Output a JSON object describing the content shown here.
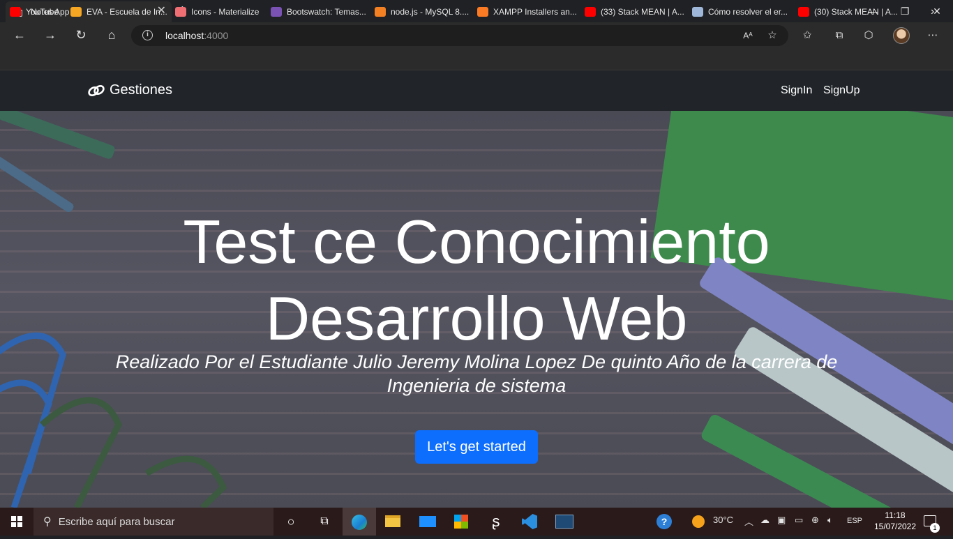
{
  "browser": {
    "tab_title": "Notes App",
    "url_host": "localhost",
    "url_port": ":4000",
    "bookmarks": [
      {
        "label": "YouTube",
        "icon": "youtube-icon",
        "color": "#ff0000"
      },
      {
        "label": "EVA - Escuela de In...",
        "icon": "eva-icon",
        "color": "#f5a623"
      },
      {
        "label": "Icons - Materialize",
        "icon": "materialize-icon",
        "color": "#ee6e73"
      },
      {
        "label": "Bootswatch: Temas...",
        "icon": "bootswatch-icon",
        "color": "#7952b3"
      },
      {
        "label": "node.js - MySQL 8....",
        "icon": "stackoverflow-icon",
        "color": "#f48024"
      },
      {
        "label": "XAMPP Installers an...",
        "icon": "xampp-icon",
        "color": "#fb7a24"
      },
      {
        "label": "(33) Stack MEAN | A...",
        "icon": "youtube-icon",
        "color": "#ff0000"
      },
      {
        "label": "Cómo resolver el er...",
        "icon": "website-icon",
        "color": "#9fb7d8"
      },
      {
        "label": "(30) Stack MEAN | A...",
        "icon": "youtube-icon",
        "color": "#ff0000"
      }
    ]
  },
  "navbar": {
    "brand": "Gestiones",
    "links": [
      "SignIn",
      "SignUp"
    ]
  },
  "hero": {
    "title_line1": "Test ce Conocimiento",
    "title_line2": "Desarrollo Web",
    "subtitle": "Realizado Por el Estudiante Julio Jeremy Molina Lopez De quinto Año de la carrera de Ingenieria de sistema",
    "button": "Let's get started",
    "button_color": "#0d6efd"
  },
  "taskbar": {
    "search_placeholder": "Escribe aquí para buscar",
    "weather": "30°C",
    "language": "ESP",
    "time": "11:18",
    "date": "15/07/2022",
    "notifications": "1"
  }
}
